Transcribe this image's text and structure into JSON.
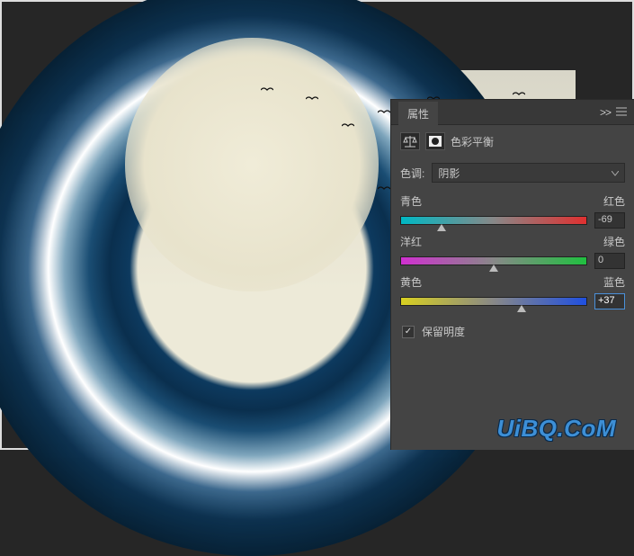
{
  "panel": {
    "title": "属性",
    "adjustment_name": "色彩平衡",
    "tone_label": "色调:",
    "tone_value": "阴影",
    "sliders": [
      {
        "left": "青色",
        "right": "红色",
        "value": "-69",
        "pos": 22,
        "grad": "grad-cr",
        "highlight": false
      },
      {
        "left": "洋红",
        "right": "绿色",
        "value": "0",
        "pos": 50,
        "grad": "grad-mg",
        "highlight": false
      },
      {
        "left": "黄色",
        "right": "蓝色",
        "value": "+37",
        "pos": 65,
        "grad": "grad-yb",
        "highlight": true
      }
    ],
    "preserve_luminosity": "保留明度",
    "collapse": ">>"
  },
  "watermark": "UiBQ.CoM"
}
